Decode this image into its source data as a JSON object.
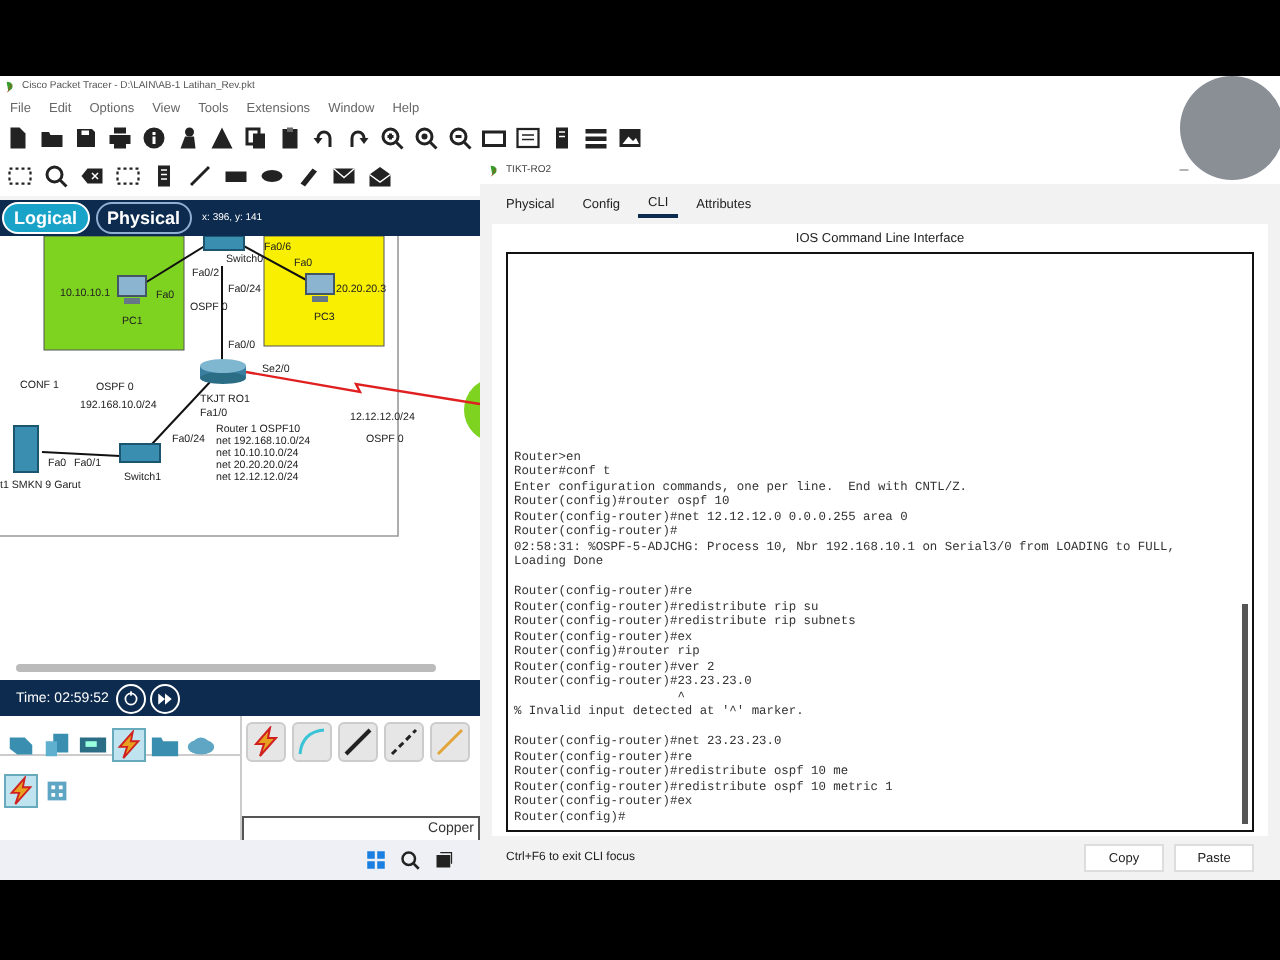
{
  "window": {
    "title": "Cisco Packet Tracer - D:\\LAIN\\AB-1 Latihan_Rev.pkt"
  },
  "menu": [
    "File",
    "Edit",
    "Options",
    "View",
    "Tools",
    "Extensions",
    "Window",
    "Help"
  ],
  "workspace_modes": [
    {
      "label": "Logical",
      "selected": true
    },
    {
      "label": "Physical",
      "selected": false
    }
  ],
  "cursor_position": "x: 396, y: 141",
  "topology": {
    "labels": [
      "10.10.10.1",
      "PC1",
      "Fa0",
      "Fa0/2",
      "Switch0",
      "Fa0/6",
      "Fa0",
      "20.20.20.3",
      "PC3",
      "Fa0/24",
      "OSPF 0",
      "Fa0/0",
      "Se2/0",
      "TKJT RO1",
      "CONF 1",
      "OSPF 0",
      "192.168.10.0/24",
      "Fa1/0",
      "12.12.12.0/24",
      "Router 1 OSPF10",
      "Fa0/24",
      "net 192.168.10.0/24",
      "OSPF 0",
      "net 10.10.10.0/24",
      "net 20.20.20.0/24",
      "net 12.12.12.0/24",
      "Fa0",
      "Fa0/1",
      "Switch1",
      "t1 SMKN 9 Garut"
    ]
  },
  "simulation": {
    "time": "Time: 02:59:52"
  },
  "palette": {
    "device_categories": [
      {
        "selected": false
      },
      {
        "selected": false
      },
      {
        "selected": false
      },
      {
        "selected": true
      },
      {
        "selected": false
      },
      {
        "selected": false
      }
    ],
    "subcategories": [
      {
        "selected": true
      },
      {
        "selected": false
      }
    ],
    "cable_type": "Copper"
  },
  "cli_window": {
    "title": "TIKT-RO2",
    "tabs": [
      {
        "label": "Physical",
        "selected": false
      },
      {
        "label": "Config",
        "selected": false
      },
      {
        "label": "CLI",
        "selected": true
      },
      {
        "label": "Attributes",
        "selected": false
      }
    ],
    "heading": "IOS Command Line Interface",
    "blocks": [
      [
        "Router>en",
        "Router#conf t",
        "Enter configuration commands, one per line.  End with CNTL/Z.",
        "Router(config)#router ospf 10",
        "Router(config-router)#net 12.12.12.0 0.0.0.255 area 0",
        "Router(config-router)#",
        "02:58:31: %OSPF-5-ADJCHG: Process 10, Nbr 192.168.10.1 on Serial3/0 from LOADING to FULL,",
        "Loading Done"
      ],
      [
        "Router(config-router)#re",
        "Router(config-router)#redistribute rip su",
        "Router(config-router)#redistribute rip subnets",
        "Router(config-router)#ex",
        "Router(config)#router rip",
        "Router(config-router)#ver 2",
        "Router(config-router)#23.23.23.0",
        "                      ^",
        "% Invalid input detected at '^' marker."
      ],
      [
        "Router(config-router)#net 23.23.23.0",
        "Router(config-router)#re",
        "Router(config-router)#redistribute ospf 10 me",
        "Router(config-router)#redistribute ospf 10 metric 1",
        "Router(config-router)#ex",
        "Router(config)#"
      ]
    ],
    "hint": "Ctrl+F6 to exit CLI focus",
    "buttons": [
      "Copy",
      "Paste"
    ]
  }
}
